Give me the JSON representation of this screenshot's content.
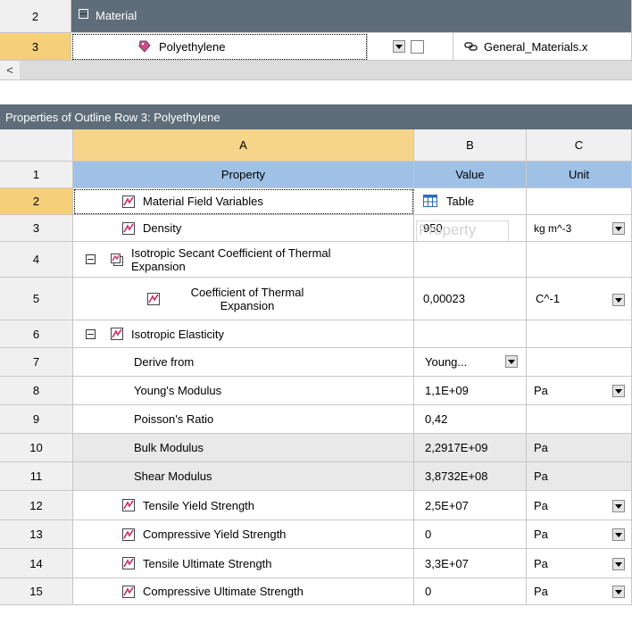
{
  "outline": {
    "rows": [
      {
        "num": "2",
        "label": "Material"
      },
      {
        "num": "3",
        "label": "Polyethylene",
        "source": "General_Materials.x"
      }
    ],
    "scroll_left": "<"
  },
  "panel": {
    "title": "Properties of Outline Row 3: Polyethylene"
  },
  "grid": {
    "columns": [
      "A",
      "B",
      "C"
    ],
    "header_row": {
      "num": "1",
      "a": "Property",
      "b": "Value",
      "c": "Unit"
    },
    "rows": [
      {
        "num": "2",
        "a": "Material Field Variables",
        "b": "Table",
        "c": ""
      },
      {
        "num": "3",
        "a": "Density",
        "b": "950",
        "c": "kg m^-3",
        "watermark": "Property"
      },
      {
        "num": "4",
        "a": "Isotropic Secant Coefficient of Thermal Expansion",
        "b": "",
        "c": ""
      },
      {
        "num": "5",
        "a": "Coefficient of Thermal Expansion",
        "b": "0,00023",
        "c": "C^-1"
      },
      {
        "num": "6",
        "a": "Isotropic Elasticity",
        "b": "",
        "c": ""
      },
      {
        "num": "7",
        "a": "Derive from",
        "b": "Young...",
        "c": ""
      },
      {
        "num": "8",
        "a": "Young's Modulus",
        "b": "1,1E+09",
        "c": "Pa"
      },
      {
        "num": "9",
        "a": "Poisson's Ratio",
        "b": "0,42",
        "c": ""
      },
      {
        "num": "10",
        "a": "Bulk Modulus",
        "b": "2,2917E+09",
        "c": "Pa"
      },
      {
        "num": "11",
        "a": "Shear Modulus",
        "b": "3,8732E+08",
        "c": "Pa"
      },
      {
        "num": "12",
        "a": "Tensile Yield Strength",
        "b": "2,5E+07",
        "c": "Pa"
      },
      {
        "num": "13",
        "a": "Compressive Yield Strength",
        "b": "0",
        "c": "Pa"
      },
      {
        "num": "14",
        "a": "Tensile Ultimate Strength",
        "b": "3,3E+07",
        "c": "Pa"
      },
      {
        "num": "15",
        "a": "Compressive Ultimate Strength",
        "b": "0",
        "c": "Pa"
      }
    ]
  },
  "colors": {
    "title_bar": "#5f6d7a",
    "selected_row": "#f5cf7a",
    "property_header": "#9fc1e6"
  }
}
